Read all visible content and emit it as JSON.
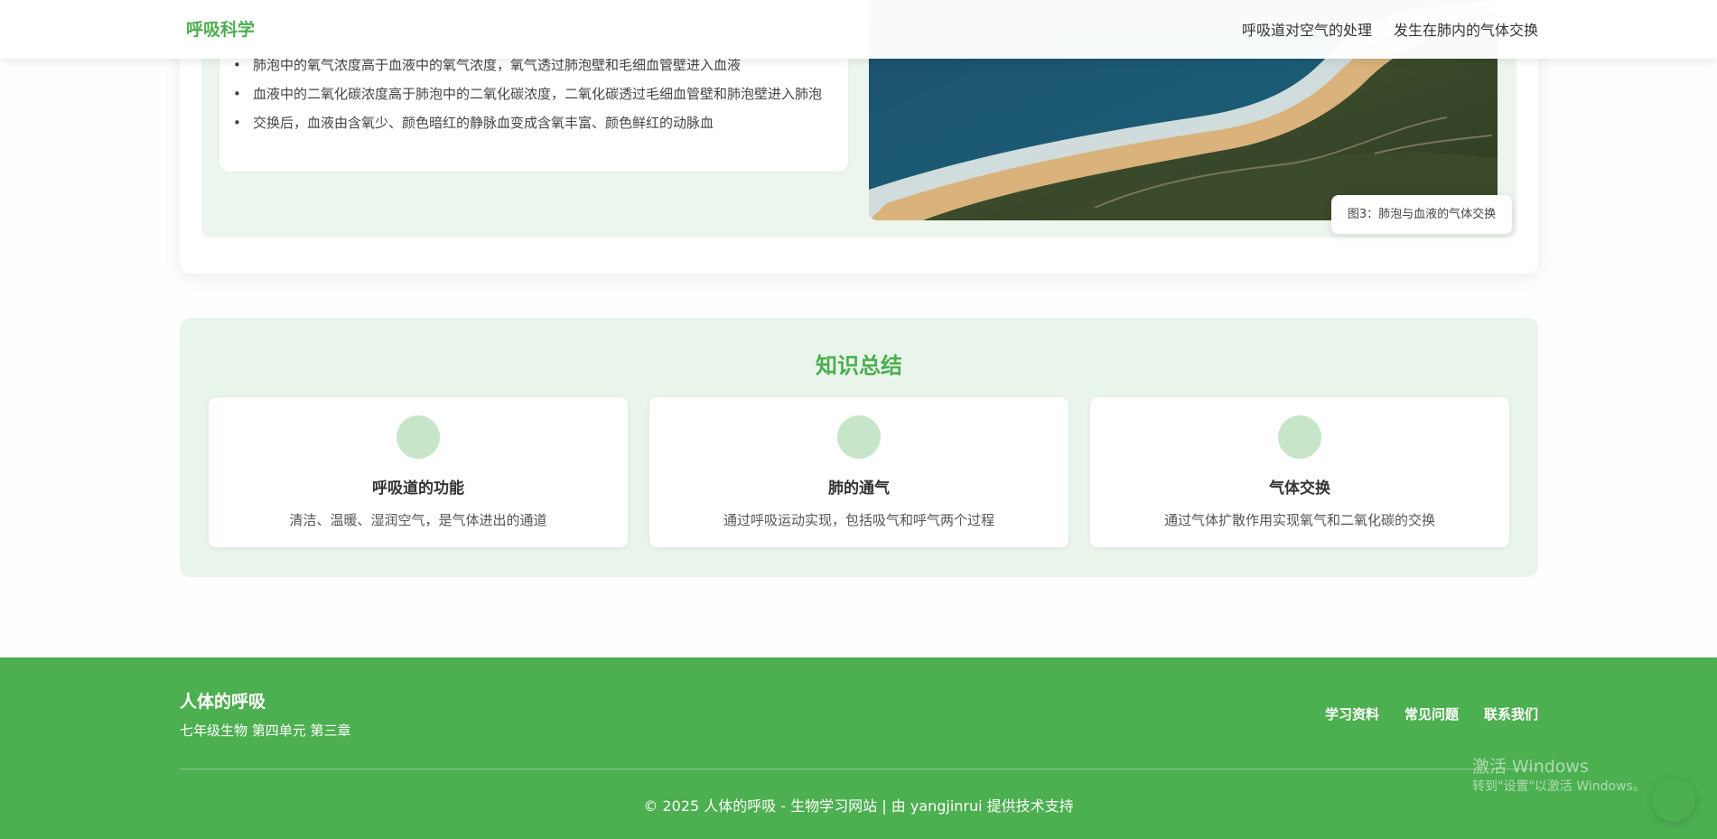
{
  "header": {
    "logo": "呼吸科学",
    "nav": [
      "呼吸道对空气的处理",
      "发生在肺内的气体交换"
    ]
  },
  "exchange": {
    "points": [
      "肺泡中的氧气浓度高于血液中的氧气浓度，氧气透过肺泡壁和毛细血管壁进入血液",
      "血液中的二氧化碳浓度高于肺泡中的二氧化碳浓度，二氧化碳透过毛细血管壁和肺泡壁进入肺泡",
      "交换后，血液由含氧少、颜色暗红的静脉血变成含氧丰富、颜色鲜红的动脉血"
    ],
    "caption": "图3：肺泡与血液的气体交换"
  },
  "summary": {
    "title": "知识总结",
    "cards": [
      {
        "title": "呼吸道的功能",
        "desc": "清洁、温暖、湿润空气，是气体进出的通道"
      },
      {
        "title": "肺的通气",
        "desc": "通过呼吸运动实现，包括吸气和呼气两个过程"
      },
      {
        "title": "气体交换",
        "desc": "通过气体扩散作用实现氧气和二氧化碳的交换"
      }
    ]
  },
  "footer": {
    "title": "人体的呼吸",
    "subtitle": "七年级生物 第四单元 第三章",
    "links": [
      "学习资料",
      "常见问题",
      "联系我们"
    ],
    "copyright": "© 2025 人体的呼吸 - 生物学习网站 | 由 yangjinrui 提供技术支持"
  },
  "watermark": {
    "line1": "激活 Windows",
    "line2": "转到\"设置\"以激活 Windows。"
  },
  "colors": {
    "accent": "#4caf50",
    "panel_bg": "#edf6ee",
    "icon_bg": "#c7e6c9"
  }
}
